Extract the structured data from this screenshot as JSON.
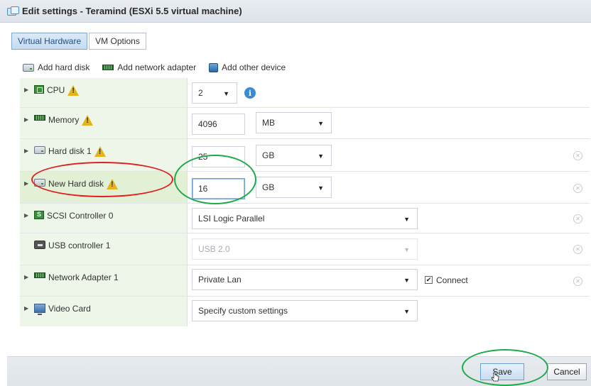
{
  "window": {
    "title": "Edit settings - Teramind (ESXi 5.5 virtual machine)"
  },
  "tabs": [
    {
      "label": "Virtual Hardware",
      "active": true
    },
    {
      "label": "VM Options",
      "active": false
    }
  ],
  "toolbar": {
    "add_hard_disk": "Add hard disk",
    "add_network_adapter": "Add network adapter",
    "add_other_device": "Add other device"
  },
  "rows": {
    "cpu": {
      "label": "CPU",
      "value": "2"
    },
    "memory": {
      "label": "Memory",
      "value": "4096",
      "unit": "MB"
    },
    "hard_disk_1": {
      "label": "Hard disk 1",
      "value": "25",
      "unit": "GB"
    },
    "new_hard_disk": {
      "label": "New Hard disk",
      "value": "16",
      "unit": "GB"
    },
    "scsi": {
      "label": "SCSI Controller 0",
      "value": "LSI Logic Parallel"
    },
    "usb": {
      "label": "USB controller 1",
      "value": "USB 2.0"
    },
    "network": {
      "label": "Network Adapter 1",
      "value": "Private Lan",
      "connect_label": "Connect",
      "connected": true
    },
    "video": {
      "label": "Video Card",
      "value": "Specify custom settings"
    }
  },
  "footer": {
    "save_label": "Save",
    "cancel_label": "Cancel"
  },
  "colors": {
    "annotation_red": "#e02020",
    "annotation_green": "#21a84a",
    "row_label_bg": "#eef5e9"
  }
}
